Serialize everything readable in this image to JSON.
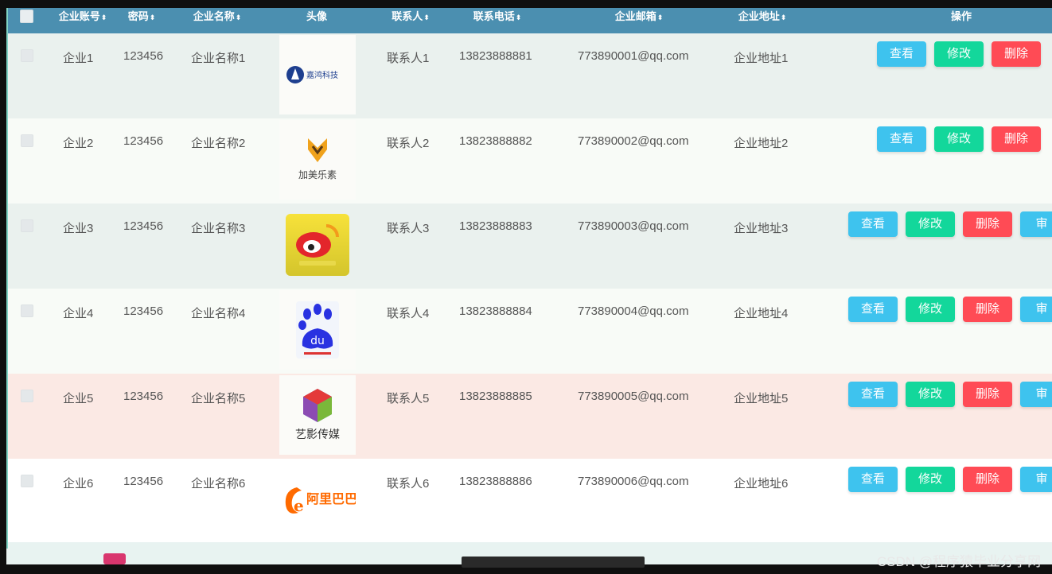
{
  "header": {
    "columns": [
      "企业账号",
      "密码",
      "企业名称",
      "头像",
      "联系人",
      "联系电话",
      "企业邮箱",
      "企业地址",
      "操作"
    ],
    "sort_glyph": "⬍"
  },
  "rows": [
    {
      "account": "企业1",
      "password": "123456",
      "name": "企业名称1",
      "logo": "嘉鸿科技",
      "contact": "联系人1",
      "phone": "13823888881",
      "email": "773890001@qq.com",
      "address": "企业地址1"
    },
    {
      "account": "企业2",
      "password": "123456",
      "name": "企业名称2",
      "logo": "加美乐素",
      "contact": "联系人2",
      "phone": "13823888882",
      "email": "773890002@qq.com",
      "address": "企业地址2"
    },
    {
      "account": "企业3",
      "password": "123456",
      "name": "企业名称3",
      "logo": "weibo",
      "contact": "联系人3",
      "phone": "13823888883",
      "email": "773890003@qq.com",
      "address": "企业地址3"
    },
    {
      "account": "企业4",
      "password": "123456",
      "name": "企业名称4",
      "logo": "du",
      "contact": "联系人4",
      "phone": "13823888884",
      "email": "773890004@qq.com",
      "address": "企业地址4"
    },
    {
      "account": "企业5",
      "password": "123456",
      "name": "企业名称5",
      "logo": "艺影传媒",
      "contact": "联系人5",
      "phone": "13823888885",
      "email": "773890005@qq.com",
      "address": "企业地址5"
    },
    {
      "account": "企业6",
      "password": "123456",
      "name": "企业名称6",
      "logo": "阿里巴巴",
      "contact": "联系人6",
      "phone": "13823888886",
      "email": "773890006@qq.com",
      "address": "企业地址6"
    }
  ],
  "actions": {
    "view": "查看",
    "edit": "修改",
    "delete": "删除",
    "audit": "审核"
  },
  "logos": {
    "r2_text": "加美乐素",
    "r5_text": "艺影传媒",
    "r6_text": "阿里巴巴",
    "r4_text": "du"
  },
  "colors": {
    "header": "#4b8fb0",
    "view": "#3ec3ee",
    "edit": "#13d79b",
    "delete": "#ff4b55"
  },
  "watermark": "CSDN @程序猿毕业分享网"
}
